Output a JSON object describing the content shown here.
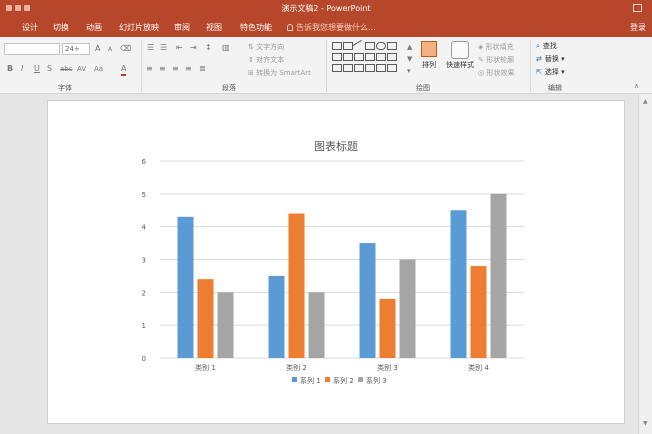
{
  "window": {
    "title": "演示文稿2 - PowerPoint"
  },
  "tabs": [
    "设计",
    "切换",
    "动画",
    "幻灯片放映",
    "审阅",
    "视图",
    "特色功能"
  ],
  "tell_me": "告诉我您想要做什么...",
  "login": "登录",
  "ribbon": {
    "font": {
      "size": "24+",
      "label": "字体",
      "grow": "A",
      "shrink": "A",
      "bold": "B",
      "italic": "I",
      "underline": "U",
      "shadow": "S",
      "strike": "abc",
      "spacing": "AV",
      "case": "Aa",
      "color": "A"
    },
    "paragraph": {
      "label": "段落",
      "text_direction": "文字方向",
      "align_text": "对齐文本",
      "smartart": "转换为 SmartArt"
    },
    "drawing": {
      "label": "绘图",
      "arrange": "排列",
      "quick_styles": "快速样式",
      "shape_fill": "形状填充",
      "shape_outline": "形状轮廓",
      "shape_effects": "形状效果"
    },
    "editing": {
      "label": "编辑",
      "find": "查找",
      "replace": "替换",
      "select": "选择"
    }
  },
  "colors": {
    "accent": "#b7472a",
    "series1": "#5b9bd5",
    "series2": "#ed7d31",
    "series3": "#a5a5a5"
  },
  "chart_data": {
    "type": "bar",
    "title": "图表标题",
    "categories": [
      "类别 1",
      "类别 2",
      "类别 3",
      "类别 4"
    ],
    "series": [
      {
        "name": "系列 1",
        "values": [
          4.3,
          2.5,
          3.5,
          4.5
        ]
      },
      {
        "name": "系列 2",
        "values": [
          2.4,
          4.4,
          1.8,
          2.8
        ]
      },
      {
        "name": "系列 3",
        "values": [
          2,
          2,
          3,
          5
        ]
      }
    ],
    "yticks": [
      "0",
      "1",
      "2",
      "3",
      "4",
      "5",
      "6"
    ],
    "ylim": [
      0,
      6
    ],
    "grid": true,
    "legend": "bottom"
  }
}
